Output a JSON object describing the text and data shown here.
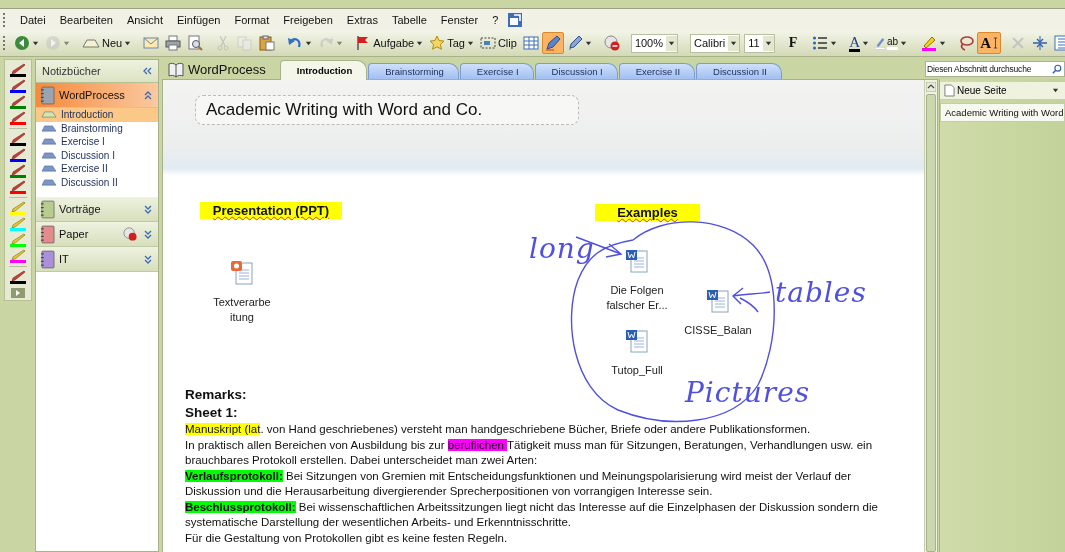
{
  "menu": [
    {
      "label": "Datei"
    },
    {
      "label": "Bearbeiten"
    },
    {
      "label": "Ansicht"
    },
    {
      "label": "Einfügen"
    },
    {
      "label": "Format"
    },
    {
      "label": "Freigeben"
    },
    {
      "label": "Extras"
    },
    {
      "label": "Tabelle"
    },
    {
      "label": "Fenster"
    },
    {
      "label": "?"
    }
  ],
  "toolbar": [
    {
      "kind": "back",
      "menu": true,
      "disabled": false
    },
    {
      "kind": "forward",
      "menu": true,
      "disabled": true
    },
    {
      "kind": "sep"
    },
    {
      "kind": "new",
      "label": "Neu",
      "menu": true,
      "disabled": false
    },
    {
      "kind": "sep"
    },
    {
      "kind": "mail",
      "disabled": false
    },
    {
      "kind": "print",
      "disabled": false
    },
    {
      "kind": "preview",
      "disabled": false
    },
    {
      "kind": "sep"
    },
    {
      "kind": "cut",
      "disabled": true
    },
    {
      "kind": "copy",
      "disabled": true
    },
    {
      "kind": "paste",
      "disabled": false
    },
    {
      "kind": "sep"
    },
    {
      "kind": "undo",
      "menu": true,
      "disabled": false
    },
    {
      "kind": "redo",
      "menu": true,
      "disabled": true
    },
    {
      "kind": "sep"
    },
    {
      "kind": "task",
      "label": "Aufgabe",
      "menu": true,
      "disabled": false
    },
    {
      "kind": "tag",
      "label": "Tag",
      "menu": true,
      "disabled": false
    },
    {
      "kind": "clip",
      "label": "Clip",
      "disabled": false
    },
    {
      "kind": "table",
      "disabled": false
    },
    {
      "kind": "penmode",
      "selected": true,
      "disabled": false
    },
    {
      "kind": "pen",
      "menu": true,
      "selected": false,
      "disabled": false
    },
    {
      "kind": "sep"
    },
    {
      "kind": "sync",
      "disabled": false
    },
    {
      "kind": "sep"
    },
    {
      "kind": "zoom",
      "label": "100%"
    },
    {
      "kind": "grip"
    },
    {
      "kind": "font",
      "label": "Calibri"
    },
    {
      "kind": "size",
      "label": "11"
    },
    {
      "kind": "sep"
    },
    {
      "kind": "bold",
      "label": "F",
      "disabled": false
    },
    {
      "kind": "sep"
    },
    {
      "kind": "bullets",
      "menu": true,
      "disabled": false
    },
    {
      "kind": "sep"
    },
    {
      "kind": "fontcolor",
      "label": "A",
      "menu": true,
      "disabled": false
    },
    {
      "kind": "highlight",
      "label": "ab",
      "menu": true,
      "disabled": false
    },
    {
      "kind": "grip"
    },
    {
      "kind": "highlighter",
      "menu": true,
      "selected": false,
      "disabled": false
    },
    {
      "kind": "sep"
    },
    {
      "kind": "lasso",
      "selected": false,
      "disabled": false
    },
    {
      "kind": "typemode",
      "label": "A",
      "selected": true,
      "disabled": false
    },
    {
      "kind": "sep"
    },
    {
      "kind": "delete",
      "disabled": true
    },
    {
      "kind": "space",
      "selected": false,
      "disabled": false
    },
    {
      "kind": "pagelist",
      "disabled": false
    }
  ],
  "pens": [
    {
      "kind": "pen",
      "color": "#000000"
    },
    {
      "kind": "pen",
      "color": "#0000ff"
    },
    {
      "kind": "pen",
      "color": "#008000"
    },
    {
      "kind": "pen",
      "color": "#ff0000"
    },
    {
      "kind": "pen",
      "color": "#000000"
    },
    {
      "kind": "pen",
      "color": "#0000ff"
    },
    {
      "kind": "pen",
      "color": "#008000"
    },
    {
      "kind": "pen",
      "color": "#ff0000"
    },
    {
      "kind": "highlighter",
      "color": "#ffff00"
    },
    {
      "kind": "highlighter",
      "color": "#00ffff"
    },
    {
      "kind": "highlighter",
      "color": "#00ff00"
    },
    {
      "kind": "highlighter",
      "color": "#ff00ff"
    },
    {
      "kind": "pen",
      "color": "#000000"
    }
  ],
  "notebooks": {
    "title": "Notizbücher",
    "items": [
      {
        "name": "WordProcess",
        "color": "#9aa4b0",
        "selected": true,
        "expanded": true,
        "sync_error": false,
        "sections": [
          {
            "name": "Introduction",
            "selected": true
          },
          {
            "name": "Brainstorming",
            "selected": false
          },
          {
            "name": "Exercise I",
            "selected": false
          },
          {
            "name": "Discussion I",
            "selected": false
          },
          {
            "name": "Exercise II",
            "selected": false
          },
          {
            "name": "Discussion II",
            "selected": false
          }
        ]
      },
      {
        "name": "Vorträge",
        "color": "#b9cc8f",
        "selected": false,
        "expanded": false,
        "sync_error": false
      },
      {
        "name": "Paper",
        "color": "#e28c8c",
        "selected": false,
        "expanded": false,
        "sync_error": true
      },
      {
        "name": "IT",
        "color": "#a990d8",
        "selected": false,
        "expanded": false,
        "sync_error": false
      }
    ]
  },
  "notebook_title": "WordProcess",
  "tabs": [
    {
      "label": "Introduction",
      "selected": true
    },
    {
      "label": "Brainstorming",
      "selected": false
    },
    {
      "label": "Exercise I",
      "selected": false
    },
    {
      "label": "Discussion I",
      "selected": false
    },
    {
      "label": "Exercise II",
      "selected": false
    },
    {
      "label": "Discussion II",
      "selected": false
    }
  ],
  "search": {
    "placeholder": "Diesen Abschnitt durchsuche"
  },
  "pages_pane": {
    "new_page": "Neue Seite",
    "pages": [
      {
        "title": "Academic Writing with Word",
        "selected": true
      }
    ]
  },
  "page": {
    "title": "Academic Writing with Word and Co.",
    "headings": [
      {
        "text": "Presentation (PPT)",
        "color": "#ffff00"
      },
      {
        "text": "Examples",
        "color": "#ffff00"
      }
    ],
    "attachments": [
      {
        "kind": "ppt",
        "lines": [
          "Textverarbe",
          "itung"
        ]
      },
      {
        "kind": "doc",
        "lines": [
          "Die Folgen",
          "falscher Er..."
        ]
      },
      {
        "kind": "doc",
        "lines": [
          "CISSE_Balan"
        ]
      },
      {
        "kind": "doc",
        "lines": [
          "Tutop_Full"
        ]
      }
    ],
    "ink_words": [
      "long",
      "tables",
      "Pictures"
    ],
    "remarks": [
      "Remarks:",
      "Sheet 1:"
    ],
    "paragraphs": [
      [
        {
          "text": "Manuskript (lat",
          "color": "#ffff00"
        },
        {
          "text": ". von Hand geschriebenes) versteht man handgeschriebene Bücher, Briefe oder andere Publikationsformen."
        }
      ],
      [
        {
          "text": "In praktisch allen Bereichen von Ausbildung bis zur "
        },
        {
          "text": "beruflichen ",
          "color": "#ff00ff"
        },
        {
          "text": "Tätigkeit muss man für Sitzungen, Beratungen, Verhandlungen usw. ein brauchbares Protokoll erstellen. Dabei unterscheidet man zwei Arten:"
        }
      ],
      [
        {
          "text": "Verlaufsprotokoll:",
          "color": "#00ff00",
          "bold": true
        },
        {
          "text": " Bei Sitzungen von Gremien mit Entscheidungsfunktionen  und Meinungspolarisierung wird meist der Verlauf der Diskussion und die Herausarbeitung divergierender Sprecherpositionen von vorrangigen Interesse sein."
        }
      ],
      [
        {
          "text": "Beschlussprotokoll:",
          "color": "#00ff00",
          "bold": true
        },
        {
          "text": " Bei wissenschaftlichen Arbeitssitzungen liegt nicht das Interesse auf die Einzelphasen der Diskussion sondern die systematische Darstellung der wesentlichen Arbeits- und Erkenntnisschritte."
        }
      ],
      [
        {
          "text": "Für die Gestaltung von Protokollen gibt es keine festen Regeln."
        }
      ]
    ]
  }
}
